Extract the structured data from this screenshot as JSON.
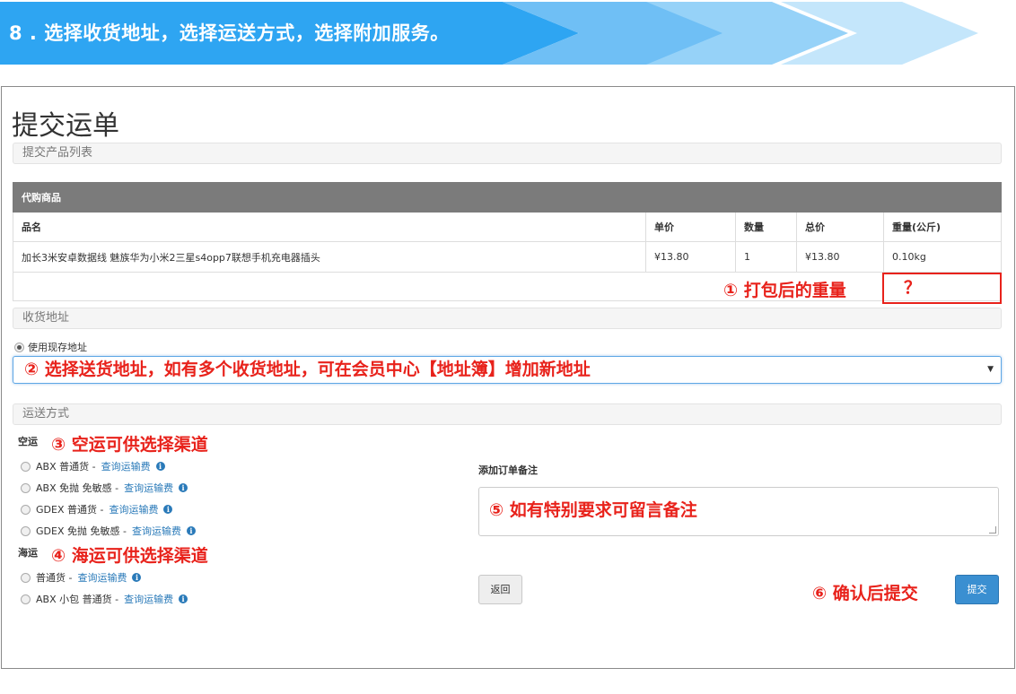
{
  "banner": {
    "text": "8 . 选择收货地址，选择运送方式，选择附加服务。",
    "colors": [
      "#2ea5f2",
      "#72c1f5",
      "#bfe3fa"
    ]
  },
  "page": {
    "title": "提交运单"
  },
  "sections": {
    "products": "提交产品列表",
    "address": "收货地址",
    "shipping": "运送方式"
  },
  "table": {
    "group_header": "代购商品",
    "columns": [
      "品名",
      "单价",
      "数量",
      "总价",
      "重量(公斤)"
    ],
    "rows": [
      [
        "加长3米安卓数据线 魅族华为小米2三星s4opp7联想手机充电器插头",
        "¥13.80",
        "1",
        "¥13.80",
        "0.10kg"
      ]
    ]
  },
  "annotations": {
    "weight": "① 打包后的重量",
    "weight_value": "？",
    "address": "② 选择送货地址，如有多个收货地址，可在会员中心【地址簿】增加新地址",
    "air": "③ 空运可供选择渠道",
    "sea": "④ 海运可供选择渠道",
    "note": "⑤ 如有特别要求可留言备注",
    "submit": "⑥ 确认后提交",
    "color": "#e8221b"
  },
  "address": {
    "use_existing_label": "使用现存地址"
  },
  "shipping": {
    "air_label": "空运",
    "air_options": [
      {
        "name": "ABX 普通货 -",
        "link": "查询运输费"
      },
      {
        "name": "ABX 免抛 免敏感 -",
        "link": "查询运输费"
      },
      {
        "name": "GDEX 普通货 -",
        "link": "查询运输费"
      },
      {
        "name": "GDEX 免抛 免敏感 -",
        "link": "查询运输费"
      }
    ],
    "sea_label": "海运",
    "sea_options": [
      {
        "name": "普通货 -",
        "link": "查询运输费"
      },
      {
        "name": "ABX 小包 普通货 -",
        "link": "查询运输费"
      }
    ]
  },
  "order_note": {
    "label": "添加订单备注"
  },
  "buttons": {
    "back": "返回",
    "submit": "提交"
  }
}
